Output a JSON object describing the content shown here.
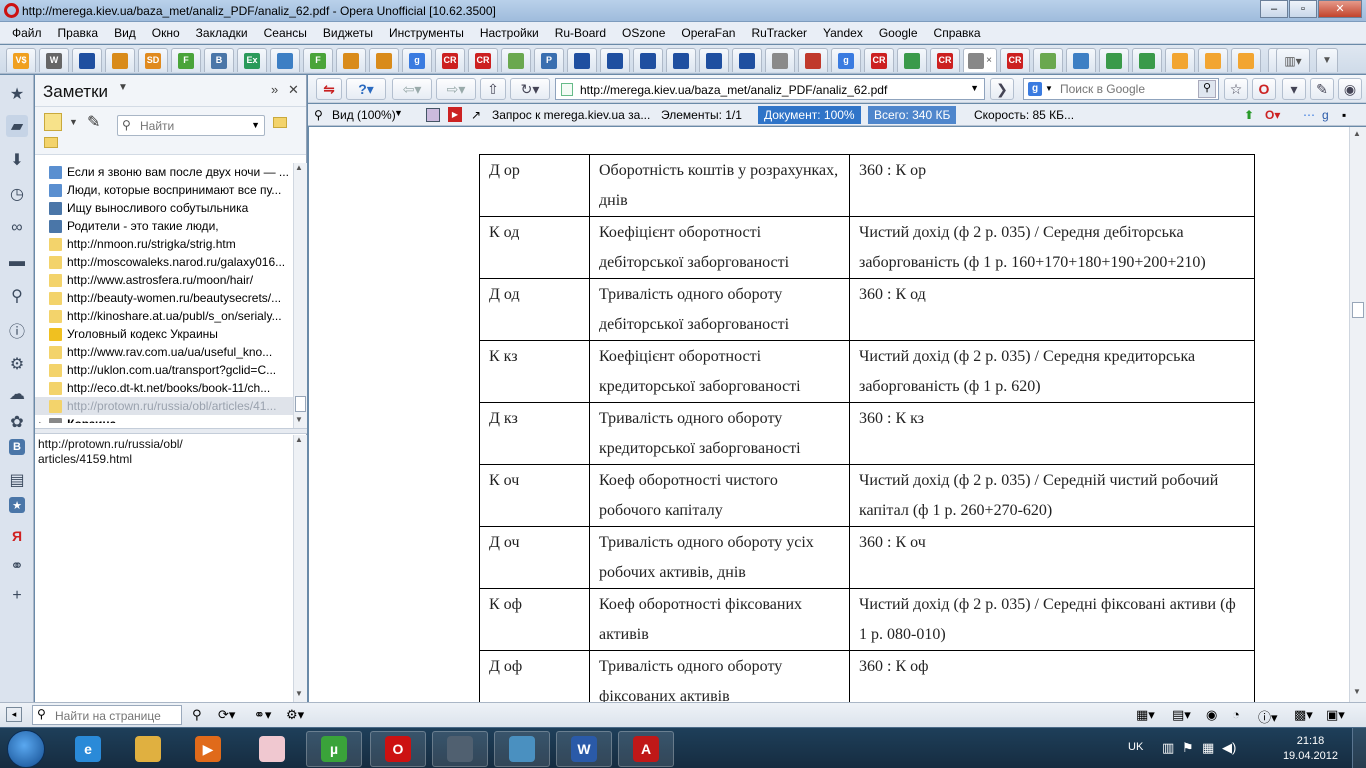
{
  "window": {
    "title": "http://merega.kiev.ua/baza_met/analiz_PDF/analiz_62.pdf - Opera Unofficial [10.62.3500]"
  },
  "menu": [
    "Файл",
    "Правка",
    "Вид",
    "Окно",
    "Закладки",
    "Сеансы",
    "Виджеты",
    "Инструменты",
    "Настройки",
    "Ru-Board",
    "OSzone",
    "OperaFan",
    "RuTracker",
    "Yandex",
    "Google",
    "Справка"
  ],
  "tabs": [
    {
      "icon": "vs-icon",
      "text": "V$",
      "color": "#f0a020"
    },
    {
      "icon": "wikipedia-icon",
      "text": "W",
      "color": "#666666"
    },
    {
      "icon": "ukraine-trident-icon",
      "text": "",
      "color": "#1f4fa0"
    },
    {
      "icon": "crown-icon",
      "text": "",
      "color": "#d98b1a"
    },
    {
      "icon": "sd-icon",
      "text": "SD",
      "color": "#e08a1e"
    },
    {
      "icon": "f-icon",
      "text": "F",
      "color": "#4aa43a"
    },
    {
      "icon": "vk-icon",
      "text": "B",
      "color": "#4a76a8"
    },
    {
      "icon": "ex-icon",
      "text": "Ex",
      "color": "#2a9a5a"
    },
    {
      "icon": "chat-icon",
      "text": "",
      "color": "#3d7fc4"
    },
    {
      "icon": "f-icon",
      "text": "F",
      "color": "#4aa43a"
    },
    {
      "icon": "crown-icon",
      "text": "",
      "color": "#d98b1a"
    },
    {
      "icon": "crown-icon",
      "text": "",
      "color": "#d98b1a"
    },
    {
      "icon": "google-icon",
      "text": "g",
      "color": "#3a7be0"
    },
    {
      "icon": "cr-icon",
      "text": "CR",
      "color": "#cc2020"
    },
    {
      "icon": "cr-icon",
      "text": "CR",
      "color": "#cc2020"
    },
    {
      "icon": "note-icon",
      "text": "",
      "color": "#6aa84f"
    },
    {
      "icon": "p-icon",
      "text": "P",
      "color": "#3a6fb0"
    },
    {
      "icon": "ukraine-trident-icon",
      "text": "",
      "color": "#1f4fa0"
    },
    {
      "icon": "ukraine-trident-icon",
      "text": "",
      "color": "#1f4fa0"
    },
    {
      "icon": "ukraine-trident-icon",
      "text": "",
      "color": "#1f4fa0"
    },
    {
      "icon": "ukraine-trident-icon",
      "text": "",
      "color": "#1f4fa0"
    },
    {
      "icon": "ukraine-trident-icon",
      "text": "",
      "color": "#1f4fa0"
    },
    {
      "icon": "ukraine-trident-icon",
      "text": "",
      "color": "#1f4fa0"
    },
    {
      "icon": "document-icon",
      "text": "",
      "color": "#8a8a8a"
    },
    {
      "icon": "stack-icon",
      "text": "",
      "color": "#c0392b"
    },
    {
      "icon": "google-icon",
      "text": "g",
      "color": "#3a7be0"
    },
    {
      "icon": "cr-icon",
      "text": "CR",
      "color": "#cc2020"
    },
    {
      "icon": "page-icon",
      "text": "",
      "color": "#3a9a4a"
    },
    {
      "icon": "cr-icon",
      "text": "CR",
      "color": "#cc2020"
    },
    {
      "icon": "pdf-tab-icon",
      "text": "",
      "color": "#888888",
      "active": true
    },
    {
      "icon": "cr-icon",
      "text": "CR",
      "color": "#cc2020"
    },
    {
      "icon": "note-icon",
      "text": "",
      "color": "#6aa84f"
    },
    {
      "icon": "people-icon",
      "text": "",
      "color": "#3d7fc4"
    },
    {
      "icon": "page-icon",
      "text": "",
      "color": "#3a9a4a"
    },
    {
      "icon": "page-icon",
      "text": "",
      "color": "#3a9a4a"
    },
    {
      "icon": "sun-icon",
      "text": "",
      "color": "#f2a531"
    },
    {
      "icon": "sun-icon",
      "text": "",
      "color": "#f2a531"
    },
    {
      "icon": "sun-icon",
      "text": "",
      "color": "#f2a531"
    }
  ],
  "notes_panel": {
    "title": "Заметки",
    "search_placeholder": "Найти",
    "items": [
      {
        "icon": "note-icon",
        "color": "#5a8fd0",
        "text": "Если я звоню вам после двух ночи — ..."
      },
      {
        "icon": "note-icon",
        "color": "#5a8fd0",
        "text": "Люди, которые воспринимают все пу..."
      },
      {
        "icon": "vk-icon",
        "color": "#4a76a8",
        "text": "Ищу выносливого собутыльника"
      },
      {
        "icon": "vk-icon",
        "color": "#4a76a8",
        "text": "Родители - это такие люди,"
      },
      {
        "icon": "note-icon",
        "color": "#f3d36b",
        "text": "http://nmoon.ru/strigka/strig.htm"
      },
      {
        "icon": "note-icon",
        "color": "#f3d36b",
        "text": "http://moscowaleks.narod.ru/galaxy016..."
      },
      {
        "icon": "note-icon",
        "color": "#f3d36b",
        "text": "http://www.astrosfera.ru/moon/hair/"
      },
      {
        "icon": "note-icon",
        "color": "#f3d36b",
        "text": "http://beauty-women.ru/beautysecrets/..."
      },
      {
        "icon": "note-icon",
        "color": "#f3d36b",
        "text": "http://kinoshare.at.ua/publ/s_on/serialy..."
      },
      {
        "icon": "ukraine-flag-icon",
        "color": "#f0c020",
        "text": "Уголовный кодекс Украины"
      },
      {
        "icon": "note-icon",
        "color": "#f3d36b",
        "text": "http://www.rav.com.ua/ua/useful_kno..."
      },
      {
        "icon": "note-icon",
        "color": "#f3d36b",
        "text": "http://uklon.com.ua/transport?gclid=C..."
      },
      {
        "icon": "note-icon",
        "color": "#f3d36b",
        "text": "http://eco.dt-kt.net/books/book-11/ch..."
      },
      {
        "icon": "note-icon",
        "color": "#f3d36b",
        "text": "http://protown.ru/russia/obl/articles/41...",
        "selected": true
      },
      {
        "icon": "trash-icon",
        "color": "#888888",
        "text": "Корзина",
        "folder": true
      }
    ],
    "detail_text": "http://protown.ru/russia/obl/\narticles/4159.html"
  },
  "navbar": {
    "url": "http://merega.kiev.ua/baza_met/analiz_PDF/analiz_62.pdf",
    "search_placeholder": "Поиск в Google"
  },
  "infobar": {
    "view": "Вид (100%)",
    "request": "Запрос к merega.kiev.ua за...",
    "elements": "Элементы:  1/1",
    "document": "Документ:  100%",
    "total": "Всего:  340 КБ",
    "speed": "Скорость:  85 КБ..."
  },
  "document": {
    "rows": [
      [
        "Д ор",
        "Оборотність коштів у розрахунках, днів",
        "360 : К ор"
      ],
      [
        "К од",
        "Коефіцієнт оборотності дебіторської заборгованості",
        "Чистий дохід (ф 2 р. 035) / Середня дебіторська заборгованість (ф 1 р. 160+170+180+190+200+210)"
      ],
      [
        "Д од",
        "Тривалість одного обороту дебіторської заборгованості",
        "360 : К од"
      ],
      [
        "К кз",
        "Коефіцієнт оборотності кредиторської заборгованості",
        "Чистий дохід (ф 2 р. 035) / Середня кредиторська заборгованість (ф 1 р. 620)"
      ],
      [
        "Д кз",
        "Тривалість одного обороту кредиторської заборгованості",
        "360 : К кз"
      ],
      [
        "К оч",
        "Коеф оборотності чистого робочого капіталу",
        "Чистий дохід (ф 2 р. 035) / Середній чистий робочий капітал (ф 1 р. 260+270-620)"
      ],
      [
        "Д оч",
        "Тривалість одного обороту усіх робочих активів, днів",
        "360 : К оч"
      ],
      [
        "К оф",
        "Коеф оборотності фіксованих активів",
        "Чистий дохід (ф 2 р. 035) / Середні фіксовані активи (ф 1 р. 080-010)"
      ],
      [
        "Д оф",
        "Тривалість одного обороту фіксованих активів",
        "360 : К оф"
      ]
    ]
  },
  "bottombar": {
    "find_placeholder": "Найти на странице"
  },
  "taskbar": {
    "apps": [
      {
        "name": "ie-icon",
        "label": "e",
        "color": "#2a8ad8",
        "open": false
      },
      {
        "name": "explorer-icon",
        "label": "",
        "color": "#e0b040",
        "open": false
      },
      {
        "name": "media-player-icon",
        "label": "▶",
        "color": "#e06a1a",
        "open": false
      },
      {
        "name": "paint-bucket-icon",
        "label": "",
        "color": "#f0c8d0",
        "open": false
      },
      {
        "name": "utorrent-icon",
        "label": "µ",
        "color": "#3aa33a",
        "open": true
      },
      {
        "name": "opera-icon",
        "label": "O",
        "color": "#cc1111",
        "open": true
      },
      {
        "name": "monitor-icon",
        "label": "",
        "color": "#506070",
        "open": true
      },
      {
        "name": "photo-viewer-icon",
        "label": "",
        "color": "#4a90c0",
        "open": true
      },
      {
        "name": "word-icon",
        "label": "W",
        "color": "#2a5aa8",
        "open": true
      },
      {
        "name": "pdf-reader-icon",
        "label": "A",
        "color": "#c01818",
        "open": true
      }
    ],
    "lang": "UK",
    "time": "21:18",
    "date": "19.04.2012"
  }
}
